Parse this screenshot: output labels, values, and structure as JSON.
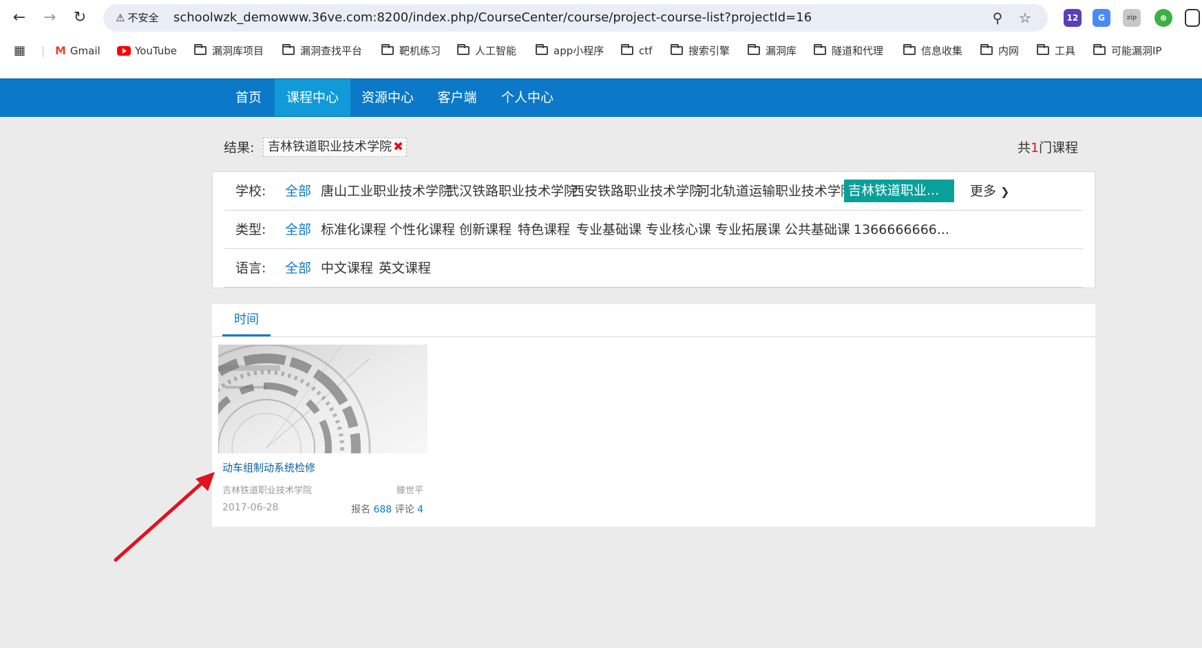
{
  "browser": {
    "security_label": "不安全",
    "url": "schoolwzk_demowww.36ve.com:8200/index.php/CourseCenter/course/project-course-list?projectId=16",
    "ext_badge_count": "12",
    "bookmarks": [
      "Gmail",
      "YouTube",
      "漏洞库项目",
      "漏洞查找平台",
      "靶机练习",
      "人工智能",
      "app小程序",
      "ctf",
      "搜索引擎",
      "漏洞库",
      "隧道和代理",
      "信息收集",
      "内网",
      "工具",
      "可能漏洞IP"
    ]
  },
  "site_nav": {
    "items": [
      "首页",
      "课程中心",
      "资源中心",
      "客户端",
      "个人中心"
    ],
    "active": "课程中心"
  },
  "result": {
    "label": "结果:",
    "chip": "吉林铁道职业技术学院",
    "remove_icon": "✖",
    "count_prefix": "共",
    "count": "1",
    "count_suffix": "门课程"
  },
  "filters": {
    "school": {
      "label": "学校:",
      "options": [
        "全部",
        "唐山工业职业技术学院",
        "武汉铁路职业技术学院",
        "西安铁路职业技术学院",
        "河北轨道运输职业技术学院",
        "吉林铁道职业..."
      ],
      "selected": "吉林铁道职业...",
      "more": "更多"
    },
    "type": {
      "label": "类型:",
      "options": [
        "全部",
        "标准化课程",
        "个性化课程",
        "创新课程",
        "特色课程",
        "专业基础课",
        "专业核心课",
        "专业拓展课",
        "公共基础课",
        "1366666666..."
      ]
    },
    "language": {
      "label": "语言:",
      "options": [
        "全部",
        "中文课程",
        "英文课程"
      ]
    }
  },
  "sort": {
    "tab": "时间"
  },
  "courses": [
    {
      "title": "动车组制动系统检修",
      "school": "吉林铁道职业技术学院",
      "teacher": "滕世平",
      "date": "2017-06-28",
      "enroll_label": "报名",
      "enroll": "688",
      "comment_label": "评论",
      "comments": "4"
    }
  ],
  "colors": {
    "nav_bg": "#0b79c8",
    "nav_active": "#109bd8",
    "selected_filter": "#0aa09a",
    "accent_red": "#e0121f"
  }
}
